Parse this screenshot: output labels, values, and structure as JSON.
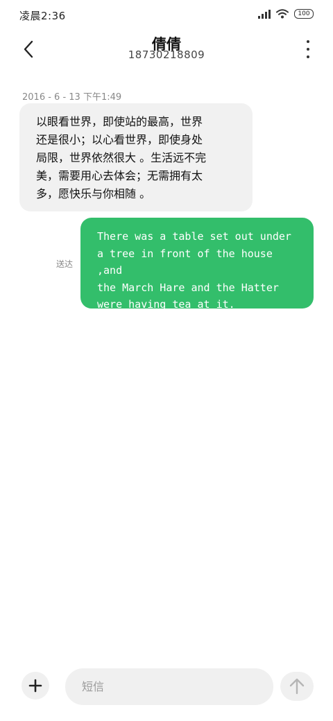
{
  "status_bar": {
    "time": "凌晨2:36",
    "battery": "100",
    "icons": [
      "signal-icon",
      "wifi-icon",
      "battery-icon"
    ]
  },
  "header": {
    "title": "倩倩",
    "subtitle": "18730218809",
    "back_icon": "chevron-left-icon",
    "more_icon": "more-vertical-icon"
  },
  "conversation": {
    "timestamp": "2016 - 6 - 13 下午1:49",
    "incoming": {
      "text": "以眼看世界，即使站的最高，世界\n还是很小；以心看世界，即使身处\n局限，世界依然很大 。生活远不完\n美，需要用心去体会；无需拥有太\n多，愿快乐与你相随 。"
    },
    "outgoing": {
      "text": "There was a table set out under\na tree in front of the house ,and\nthe March Hare and the Hatter\nwere having tea at it.",
      "status": "送达"
    }
  },
  "composer": {
    "placeholder": "短信",
    "value": "",
    "add_icon": "plus-icon",
    "send_icon": "arrow-up-icon"
  },
  "colors": {
    "outgoing_bubble": "#33be6b",
    "incoming_bubble": "#f1f1f1",
    "input_background": "#f0f0f0"
  }
}
